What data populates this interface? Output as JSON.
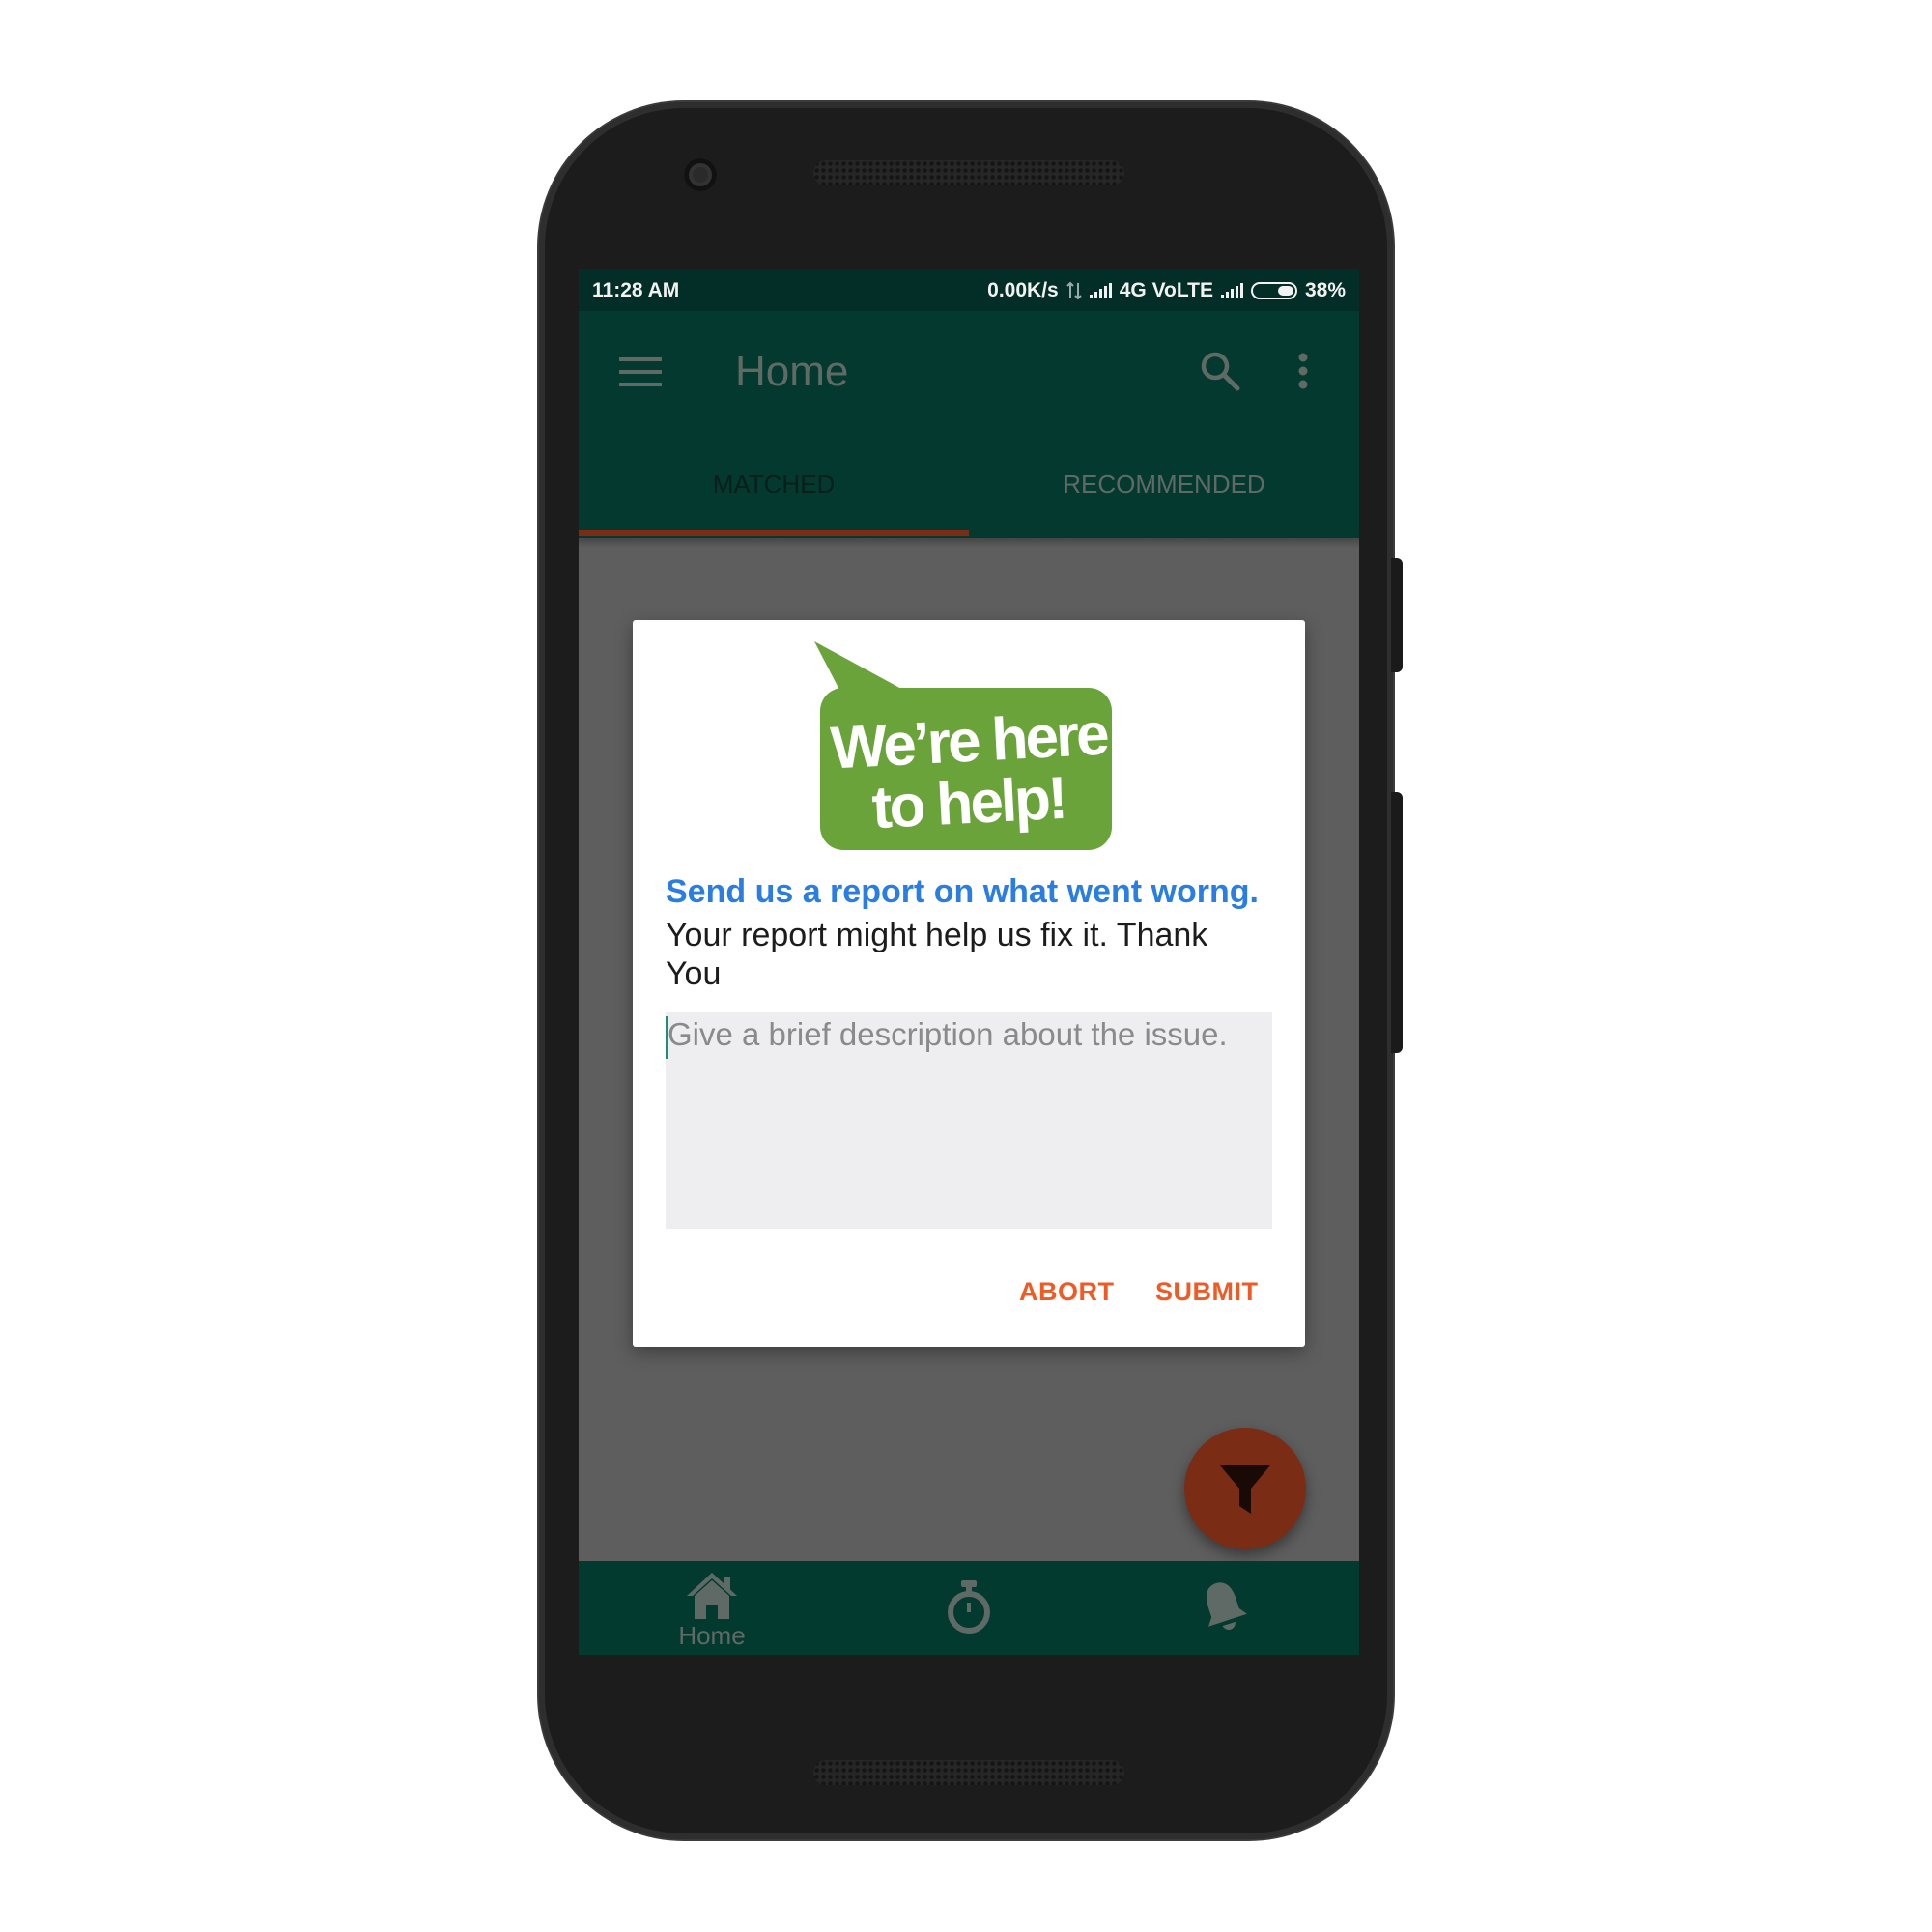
{
  "status_bar": {
    "time": "11:28 AM",
    "network_speed": "0.00K/s",
    "network_type": "4G VoLTE",
    "battery": "38%"
  },
  "app_bar": {
    "title": "Home",
    "icons": [
      "menu-icon",
      "search-icon",
      "more-vert-icon"
    ]
  },
  "tabs": [
    {
      "label": "MATCHED",
      "selected": true
    },
    {
      "label": "RECOMMENDED",
      "selected": false
    }
  ],
  "dialog": {
    "logo_text": "We're here to help!",
    "title": "Send us a report on what went worng.",
    "subtitle": "Your report might help us fix it. Thank You",
    "input": {
      "value": "",
      "placeholder": "Give a brief description about the issue."
    },
    "abort_label": "ABORT",
    "submit_label": "SUBMIT"
  },
  "fab": {
    "icon": "filter-icon"
  },
  "bottom_nav": {
    "items": [
      {
        "icon": "home-icon",
        "label": "Home"
      },
      {
        "icon": "timer-icon",
        "label": ""
      },
      {
        "icon": "bell-icon",
        "label": ""
      }
    ]
  },
  "colors": {
    "status_bar": "#032e27",
    "app_bar": "#03392f",
    "accent": "#f05a24",
    "link_blue": "#2a7de1",
    "logo_green": "#6aa33a",
    "fab": "#7a2c14"
  }
}
